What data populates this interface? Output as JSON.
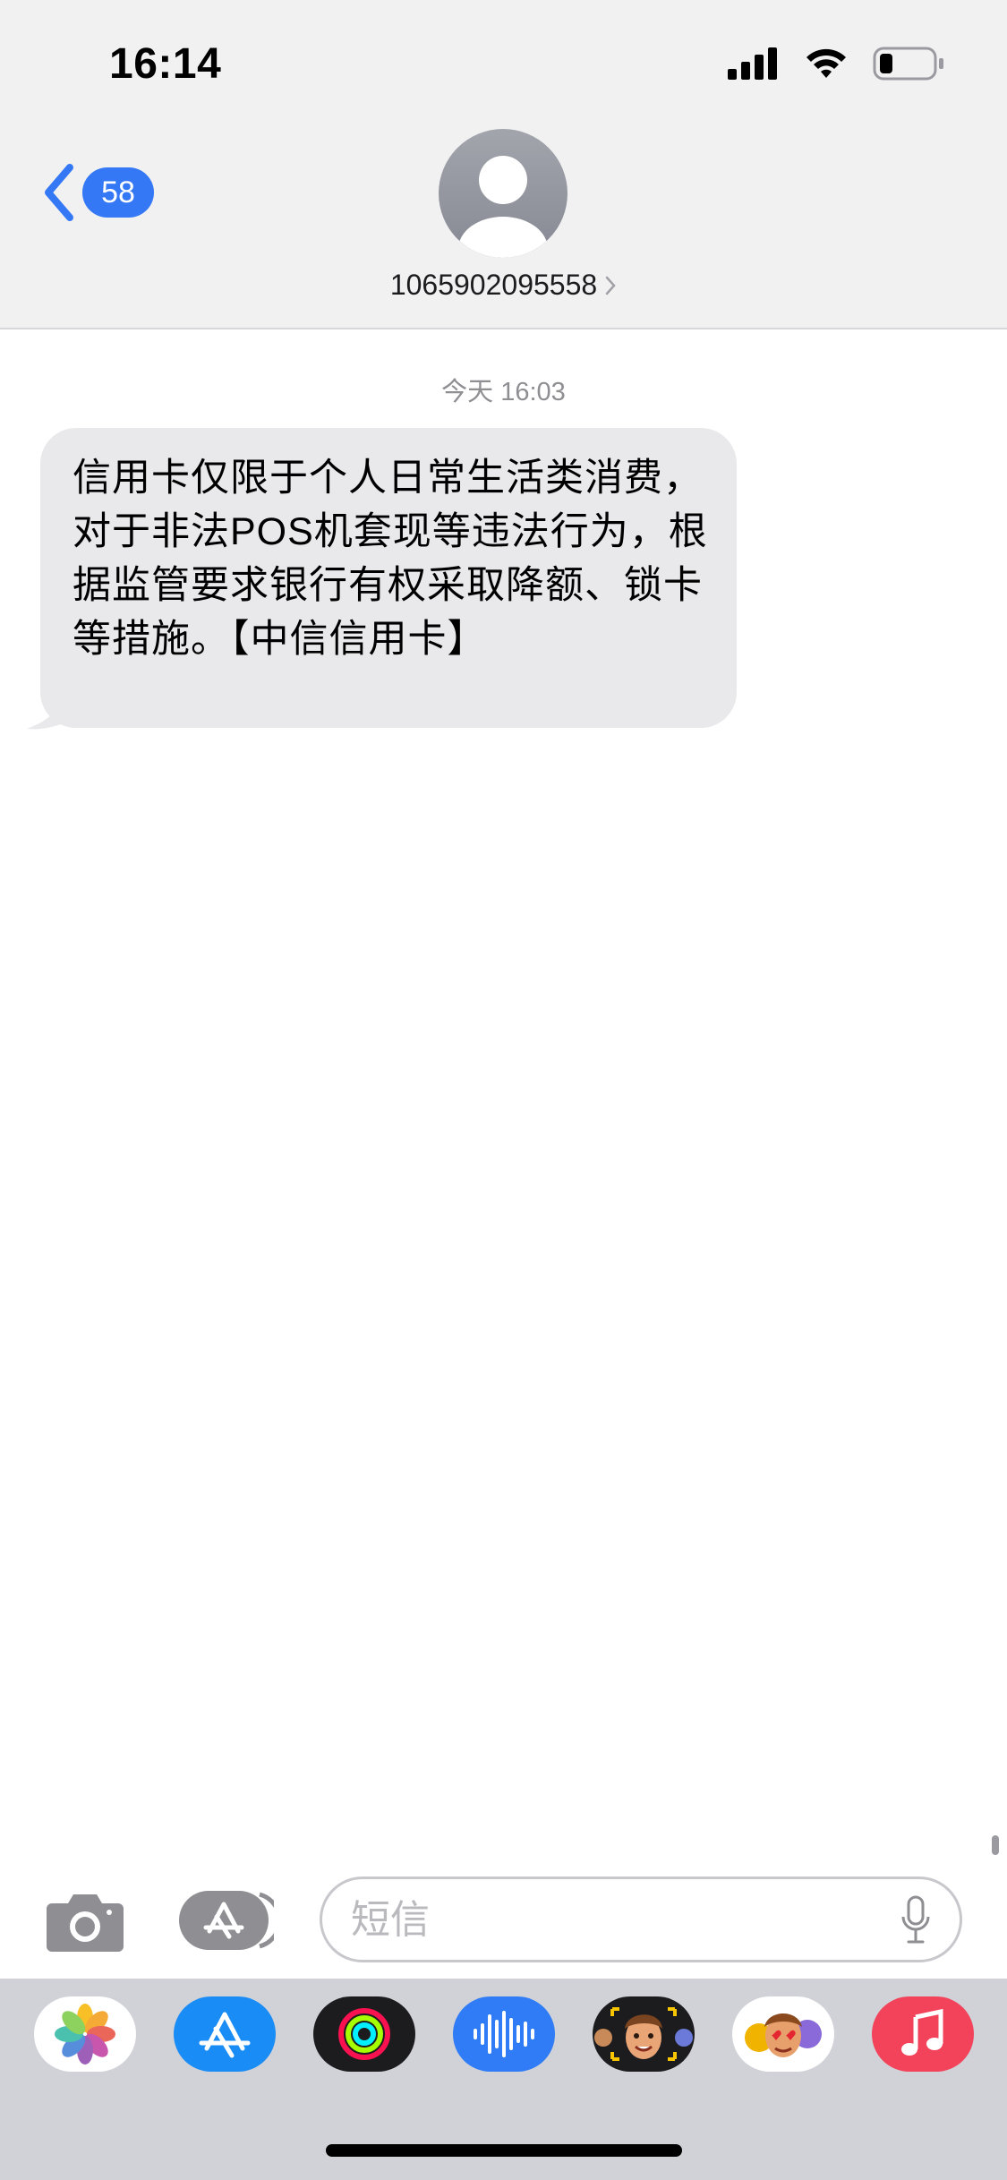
{
  "status_bar": {
    "time": "16:14"
  },
  "nav": {
    "back_count": "58",
    "contact_number": "1065902095558"
  },
  "conversation": {
    "timestamp": "今天 16:03",
    "message": "信用卡仅限于个人日常生活类消费，对于非法POS机套现等违法行为，根据监管要求银行有权采取降额、锁卡等措施。【中信信用卡】"
  },
  "compose": {
    "placeholder": "短信"
  },
  "app_drawer": {
    "apps": [
      "photos-icon",
      "app-store-icon",
      "activity-icon",
      "audio-message-icon",
      "memoji-icon",
      "animoji-stickers-icon",
      "music-icon"
    ]
  },
  "colors": {
    "accent": "#3478f6",
    "bubble": "#e9e9eb",
    "header_bg": "#f1f1f2",
    "dock_bg": "#d1d2d8"
  }
}
